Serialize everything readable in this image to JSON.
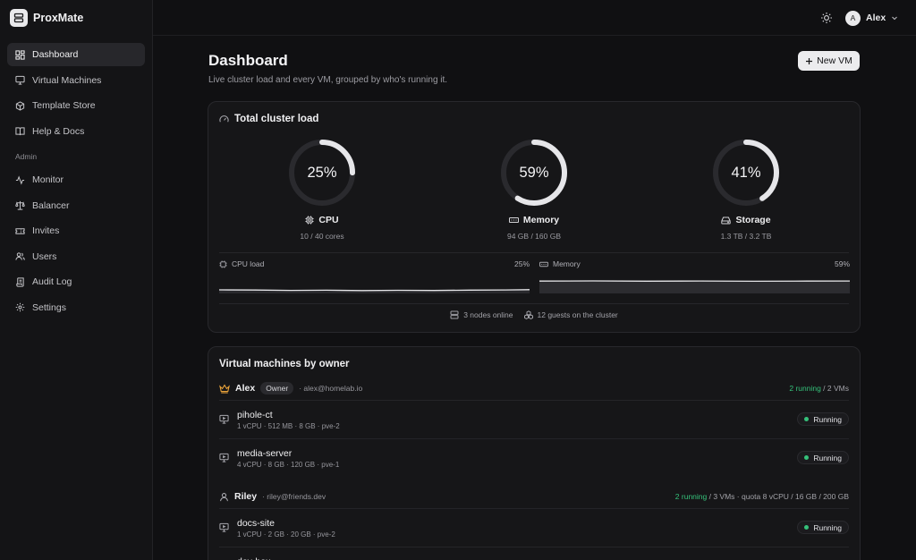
{
  "app": {
    "name": "ProxMate"
  },
  "sidebar": {
    "items": [
      {
        "label": "Dashboard",
        "icon": "dashboard-icon",
        "active": true
      },
      {
        "label": "Virtual Machines",
        "icon": "monitor-icon"
      },
      {
        "label": "Template Store",
        "icon": "package-icon"
      },
      {
        "label": "Help & Docs",
        "icon": "book-icon"
      }
    ],
    "admin_label": "Admin",
    "admin_items": [
      {
        "label": "Monitor",
        "icon": "activity-icon"
      },
      {
        "label": "Balancer",
        "icon": "scale-icon"
      },
      {
        "label": "Invites",
        "icon": "ticket-icon"
      },
      {
        "label": "Users",
        "icon": "users-icon"
      },
      {
        "label": "Audit Log",
        "icon": "scroll-icon"
      },
      {
        "label": "Settings",
        "icon": "gear-icon"
      }
    ]
  },
  "topbar": {
    "user_initial": "A",
    "user_name": "Alex"
  },
  "page": {
    "title": "Dashboard",
    "subtitle": "Live cluster load and every VM, grouped by who's running it.",
    "new_vm_label": "New VM"
  },
  "cluster": {
    "title": "Total cluster load",
    "gauges": [
      {
        "pct": "25%",
        "value": 0.25,
        "label": "CPU",
        "sub": "10 / 40 cores",
        "icon": "cpu-icon"
      },
      {
        "pct": "59%",
        "value": 0.59,
        "label": "Memory",
        "sub": "94 GB / 160 GB",
        "icon": "memory-icon"
      },
      {
        "pct": "41%",
        "value": 0.41,
        "label": "Storage",
        "sub": "1.3 TB / 3.2 TB",
        "icon": "hard-drive-icon"
      }
    ],
    "cpu_load": {
      "label": "CPU load",
      "pct": "25%",
      "value": 0.25
    },
    "mem_load": {
      "label": "Memory",
      "pct": "59%",
      "value": 0.59
    },
    "nodes": "3 nodes online",
    "guests": "12 guests on the cluster"
  },
  "vms": {
    "title": "Virtual machines by owner",
    "owners": [
      {
        "name": "Alex",
        "badge": "Owner",
        "email": "· alex@homelab.io",
        "running": "2 running",
        "rest": " / 2 VMs",
        "vms": [
          {
            "name": "pihole-ct",
            "specs": "1 vCPU · 512 MB · 8 GB · pve-2",
            "status": "Running"
          },
          {
            "name": "media-server",
            "specs": "4 vCPU · 8 GB · 120 GB · pve-1",
            "status": "Running"
          }
        ]
      },
      {
        "name": "Riley",
        "email": "· riley@friends.dev",
        "running": "2 running",
        "rest": " / 3 VMs · quota 8 vCPU / 16 GB / 200 GB",
        "vms": [
          {
            "name": "docs-site",
            "specs": "1 vCPU · 2 GB · 20 GB · pve-2",
            "status": "Running"
          },
          {
            "name": "dev-box",
            "specs": "",
            "status": ""
          }
        ]
      }
    ]
  },
  "colors": {
    "accent_green": "#35c17a",
    "background": "#101012",
    "card": "#161618"
  }
}
